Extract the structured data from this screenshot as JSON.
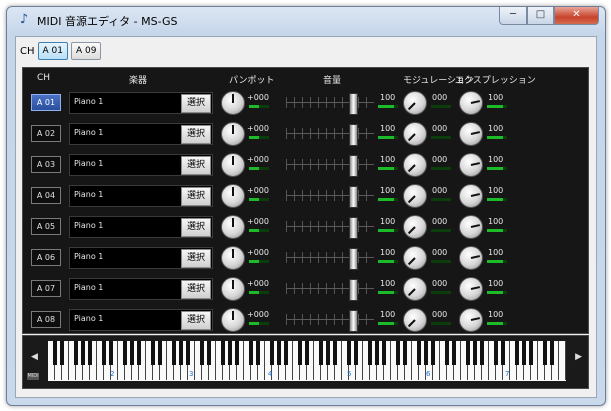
{
  "window": {
    "title": "MIDI 音源エディタ - MS-GS",
    "icon": "music-note-icon",
    "minimize_glyph": "─",
    "maximize_glyph": "□",
    "close_glyph": "✕"
  },
  "chbar": {
    "label": "CH",
    "buttons": [
      {
        "label": "A 01",
        "active": true
      },
      {
        "label": "A 09",
        "active": false
      }
    ]
  },
  "headers": {
    "ch": "CH",
    "instrument": "楽器",
    "pan": "パンポット",
    "volume": "音量",
    "modulation": "モジュレーション",
    "expression": "エクスプレッション"
  },
  "rows": [
    {
      "ch": "A 01",
      "instrument": "Piano 1",
      "select": "選択",
      "pan": "+000",
      "volume": "100",
      "modulation": "000",
      "expression": "100",
      "volume_level": 100,
      "modulation_level": 0,
      "expression_level": 100
    },
    {
      "ch": "A 02",
      "instrument": "Piano 1",
      "select": "選択",
      "pan": "+000",
      "volume": "100",
      "modulation": "000",
      "expression": "100",
      "volume_level": 100,
      "modulation_level": 0,
      "expression_level": 100
    },
    {
      "ch": "A 03",
      "instrument": "Piano 1",
      "select": "選択",
      "pan": "+000",
      "volume": "100",
      "modulation": "000",
      "expression": "100",
      "volume_level": 100,
      "modulation_level": 0,
      "expression_level": 100
    },
    {
      "ch": "A 04",
      "instrument": "Piano 1",
      "select": "選択",
      "pan": "+000",
      "volume": "100",
      "modulation": "000",
      "expression": "100",
      "volume_level": 100,
      "modulation_level": 0,
      "expression_level": 100
    },
    {
      "ch": "A 05",
      "instrument": "Piano 1",
      "select": "選択",
      "pan": "+000",
      "volume": "100",
      "modulation": "000",
      "expression": "100",
      "volume_level": 100,
      "modulation_level": 0,
      "expression_level": 100
    },
    {
      "ch": "A 06",
      "instrument": "Piano 1",
      "select": "選択",
      "pan": "+000",
      "volume": "100",
      "modulation": "000",
      "expression": "100",
      "volume_level": 100,
      "modulation_level": 0,
      "expression_level": 100
    },
    {
      "ch": "A 07",
      "instrument": "Piano 1",
      "select": "選択",
      "pan": "+000",
      "volume": "100",
      "modulation": "000",
      "expression": "100",
      "volume_level": 100,
      "modulation_level": 0,
      "expression_level": 100
    },
    {
      "ch": "A 08",
      "instrument": "Piano 1",
      "select": "選択",
      "pan": "+000",
      "volume": "100",
      "modulation": "000",
      "expression": "100",
      "volume_level": 100,
      "modulation_level": 0,
      "expression_level": 100
    }
  ],
  "piano": {
    "left_arrow": "◀",
    "right_arrow": "▶",
    "midi_icon": "MIDI",
    "octaves": [
      "2",
      "3",
      "4",
      "5",
      "6",
      "7"
    ]
  },
  "colors": {
    "selected_channel": "#3a62b4",
    "meter_green": "#1dbb2a",
    "panel_bg": "#161616"
  }
}
